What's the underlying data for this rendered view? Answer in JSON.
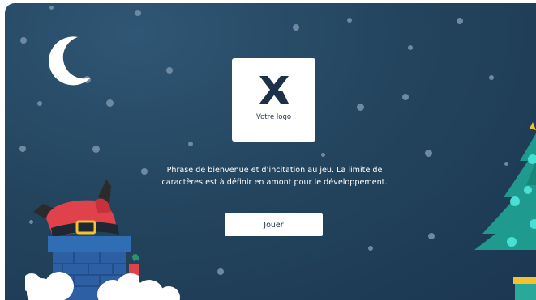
{
  "logo": {
    "icon": "x-logo-icon",
    "text": "Votre logo"
  },
  "intro": {
    "line1": "Phrase de bienvenue et d’incitation au jeu. La limite de",
    "line2": "caractères est à définir en amont pour le développement."
  },
  "play_button": {
    "label": "Jouer"
  },
  "colors": {
    "background": "#1f3e58",
    "brand_navy": "#1d3049",
    "card": "#ffffff",
    "santa_red": "#e0424c",
    "chimney_blue": "#2f6db5",
    "tree_teal": "#1f9a8e",
    "ornament": "#49e0d4"
  },
  "decorations": [
    "crescent-moon",
    "snowflakes",
    "santa-in-chimney",
    "christmas-tree",
    "gift-box",
    "snow-clouds"
  ]
}
